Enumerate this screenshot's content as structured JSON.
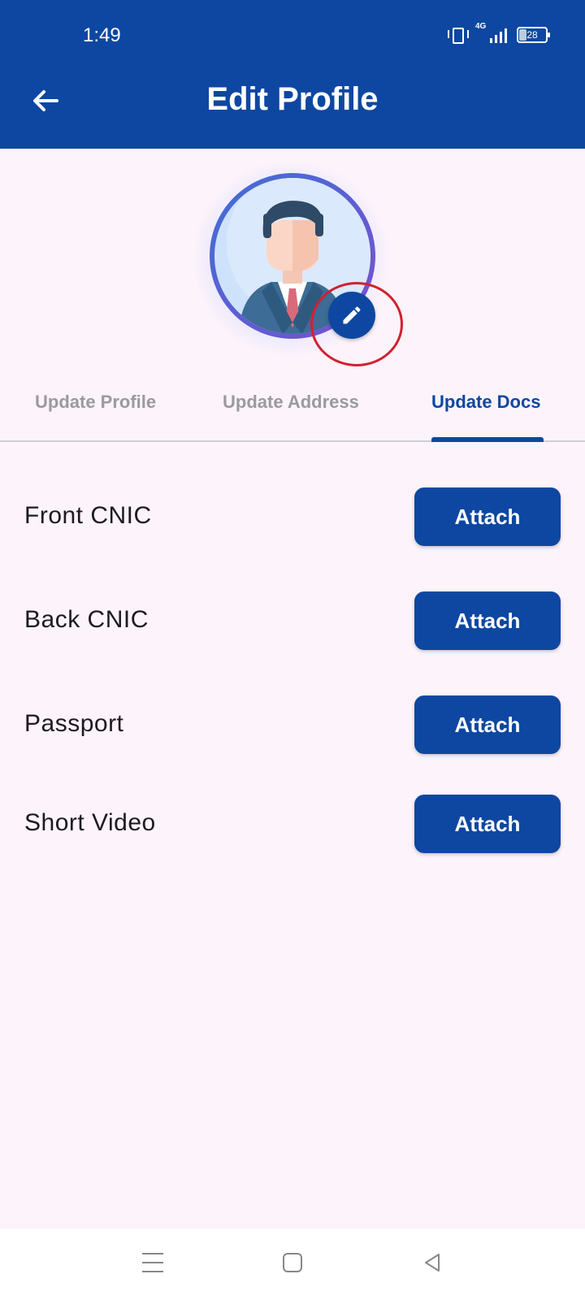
{
  "status_bar": {
    "time": "1:49",
    "network": "4G",
    "battery": "28"
  },
  "header": {
    "title": "Edit Profile"
  },
  "tabs": [
    {
      "label": "Update Profile",
      "active": false
    },
    {
      "label": "Update Address",
      "active": false
    },
    {
      "label": "Update Docs",
      "active": true
    }
  ],
  "documents": [
    {
      "label": "Front CNIC",
      "button": "Attach"
    },
    {
      "label": "Back CNIC",
      "button": "Attach"
    },
    {
      "label": "Passport",
      "button": "Attach"
    },
    {
      "label": "Short Video",
      "button": "Attach"
    }
  ],
  "colors": {
    "primary": "#0d47a1",
    "background": "#fdf3fb",
    "tab_inactive": "#9a9a9e",
    "highlight": "#d32030"
  }
}
